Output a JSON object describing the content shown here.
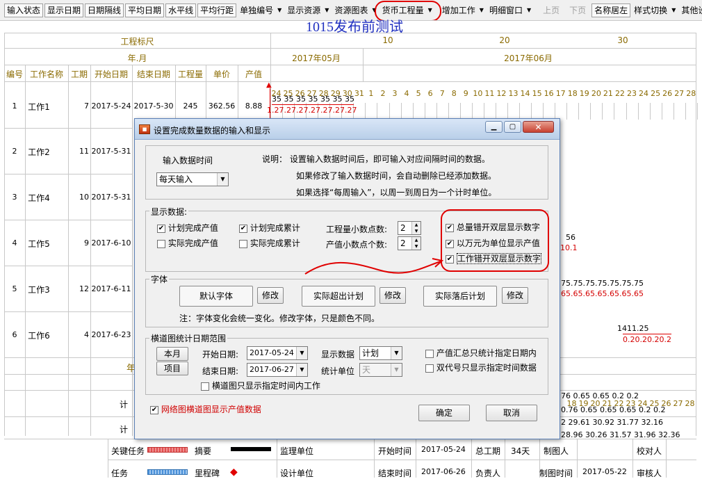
{
  "toolbar": {
    "buttons": [
      "输入状态",
      "显示日期",
      "日期隔线",
      "平均日期",
      "水平线",
      "平均行距"
    ],
    "dropdowns": [
      "单独编号",
      "显示资源",
      "资源图表",
      "货币工程量"
    ],
    "dropdowns2": [
      "增加工作",
      "明细窗口"
    ],
    "disabled": [
      "上页",
      "下页"
    ],
    "buttons2": [
      "名称居左"
    ],
    "dropdowns3": [
      "样式切换",
      "其他设"
    ]
  },
  "chart": {
    "title": "1015发布前测试",
    "scale_label": "工程标尺",
    "scale_ticks": [
      "10",
      "20",
      "30"
    ],
    "ym_label": "年.月",
    "months": [
      "2017年05月",
      "2017年06月"
    ],
    "columns": [
      "编号",
      "工作名称",
      "工期",
      "开始日期",
      "结束日期",
      "工程量",
      "单价",
      "产值"
    ],
    "days": [
      "24",
      "25",
      "26",
      "27",
      "28",
      "29",
      "30",
      "31",
      "1",
      "2",
      "3",
      "4",
      "5",
      "6",
      "7",
      "8",
      "9",
      "10",
      "11",
      "12",
      "13",
      "14",
      "15",
      "16",
      "17",
      "18",
      "19",
      "20",
      "21",
      "22",
      "23",
      "24",
      "25",
      "26",
      "27",
      "28"
    ],
    "rows": [
      {
        "no": "1",
        "name": "工作1",
        "dur": "7",
        "start": "2017-5-24",
        "end": "2017-5-30",
        "qty": "245",
        "price": "362.56",
        "value": "8.88"
      },
      {
        "no": "2",
        "name": "工作2",
        "dur": "11",
        "start": "2017-5-31"
      },
      {
        "no": "3",
        "name": "工作4",
        "dur": "10",
        "start": "2017-5-31"
      },
      {
        "no": "4",
        "name": "工作5",
        "dur": "9",
        "start": "2017-6-10"
      },
      {
        "no": "5",
        "name": "工作3",
        "dur": "12",
        "start": "2017-6-11"
      },
      {
        "no": "6",
        "name": "工作6",
        "dur": "4",
        "start": "2017-6-23"
      }
    ],
    "bar1_top": "35 35 35 35 35 35 35",
    "bar1_bot": "1.27.27.27.27.27.27.27",
    "frag_r4_top": "56",
    "frag_r4_bot": "10.1",
    "frag_r5_top": "75.75.75.75.75.75.75",
    "frag_r5_bot": "65.65.65.65.65.65.65",
    "frag_r6_top": "1411.25",
    "frag_r6_bot": "0.20.20.20.2",
    "bottom_rows": [
      "76  0.65  0.65  0.2  0.2",
      "0.76  0.65  0.65  0.65  0.2  0.2",
      "2 29.61 30.92 31.77 32.16",
      "28.96 30.26 31.57 31.96 32.36"
    ],
    "bottom_days": [
      "18",
      "19",
      "20",
      "21",
      "22",
      "23",
      "24",
      "25",
      "26",
      "27",
      "28"
    ],
    "left_bits": [
      "年",
      "计",
      "计"
    ]
  },
  "legend": {
    "key_work": "关键任务",
    "summary": "摘要",
    "task": "任务",
    "milestone": "里程碑",
    "supervisor": "监理单位",
    "design": "设计单位",
    "start_label": "开始时间",
    "start_val": "2017-05-24",
    "end_label": "结束时间",
    "end_val": "2017-06-26",
    "total_dur_label": "总工期",
    "total_dur_val": "34天",
    "owner_label": "负责人",
    "drawer_label": "制图人",
    "draw_time_label": "制图时间",
    "draw_time_val": "2017-05-22",
    "checker_label": "校对人",
    "approver_label": "审核人"
  },
  "dialog": {
    "title": "设置完成数量数据的输入和显示",
    "input_time_label": "输入数据时间",
    "input_time_value": "每天输入",
    "note1": "说明：  设置输入数据时间后，即可输入对应间隔时间的数据。",
    "note2": "如果修改了输入数据时间，会自动删除已经添加数据。",
    "note3": "如果选择“每周输入”，以周一到周日为一个计时单位。",
    "display_group": "显示数据:",
    "cb_plan_value": "计划完成产值",
    "cb_plan_cum": "计划完成累计",
    "cb_actual_value": "实际完成产值",
    "cb_actual_cum": "实际完成累计",
    "qty_decimals_label": "工程量小数点数:",
    "qty_decimals": "2",
    "value_decimals_label": "产值小数点个数:",
    "value_decimals": "2",
    "cb_total_stagger": "总量错开双层显示数字",
    "cb_wan_unit": "以万元为单位显示产值",
    "cb_work_stagger": "工作错开双层显示数字",
    "font_group": "字体",
    "default_font": "默认字体",
    "modify": "修改",
    "actual_over": "实际超出计划",
    "actual_behind": "实际落后计划",
    "font_note": "注：字体变化会统一变化。修改字体，只是颜色不同。",
    "stats_group": "横道图统计日期范围",
    "this_month": "本月",
    "project": "项目",
    "start_date_label": "开始日期:",
    "start_date": "2017-05-24",
    "end_date_label": "结束日期:",
    "end_date": "2017-06-27",
    "show_data_label": "显示数据",
    "show_data": "计划",
    "stat_unit_label": "统计单位",
    "stat_unit": "天",
    "cb_value_total": "产值汇总只统计指定日期内",
    "cb_dual_code": "双代号只显示指定时间数据",
    "cb_gantt_only": "横道图只显示指定时间内工作",
    "cb_network": "网络图横道图显示产值数据",
    "ok": "确定",
    "cancel": "取消"
  },
  "colors": {
    "annotation": "#e00000",
    "header_text": "#8a6a00",
    "title_blue": "#2030c0"
  }
}
